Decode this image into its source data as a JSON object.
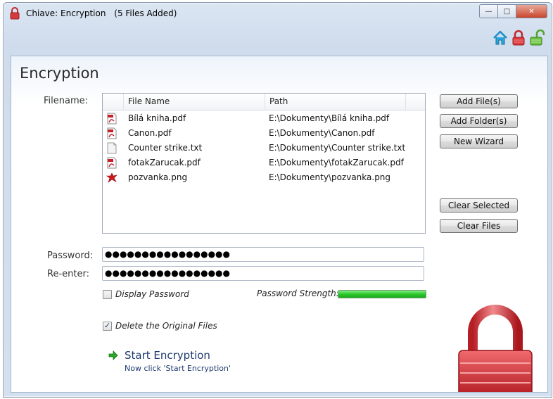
{
  "window": {
    "title": "Chiave: Encryption",
    "subtitle": "(5 Files Added)",
    "controls": {
      "minimize": "—",
      "maximize": "□",
      "close": "✕"
    }
  },
  "toolbar_icons": [
    "home-icon",
    "lock-icon",
    "unlock-icon"
  ],
  "panel": {
    "title": "Encryption",
    "filename_label": "Filename:",
    "columns": [
      "File Name",
      "Path"
    ],
    "files": [
      {
        "icon": "pdf-file-icon",
        "name": "Bílá kniha.pdf",
        "path": "E:\\Dokumenty\\Bílá kniha.pdf"
      },
      {
        "icon": "pdf-file-icon",
        "name": "Canon.pdf",
        "path": "E:\\Dokumenty\\Canon.pdf"
      },
      {
        "icon": "text-file-icon",
        "name": "Counter strike.txt",
        "path": "E:\\Dokumenty\\Counter strike.txt"
      },
      {
        "icon": "pdf-file-icon",
        "name": "fotakZarucak.pdf",
        "path": "E:\\Dokumenty\\fotakZarucak.pdf"
      },
      {
        "icon": "image-file-icon",
        "name": "pozvanka.png",
        "path": "E:\\Dokumenty\\pozvanka.png"
      }
    ],
    "buttons": {
      "add_files": "Add File(s)",
      "add_folder": "Add Folder(s)",
      "new_wizard": "New Wizard",
      "clear_selected": "Clear Selected",
      "clear_files": "Clear Files"
    },
    "password_label": "Password:",
    "password_value": "●●●●●●●●●●●●●●●●●",
    "reenter_label": "Re-enter:",
    "reenter_value": "●●●●●●●●●●●●●●●●●",
    "display_password_label": "Display Password",
    "display_password_checked": false,
    "strength_label": "Password Strength:",
    "strength_level": 1.0,
    "delete_original_label": "Delete the Original Files",
    "delete_original_checked": true,
    "start_label": "Start Encryption",
    "start_hint": "Now click 'Start Encryption'"
  },
  "colors": {
    "accent_link": "#1e3a6e",
    "strength_green": "#28c428",
    "lock_red": "#d2373c",
    "close_red": "#c9462c"
  }
}
